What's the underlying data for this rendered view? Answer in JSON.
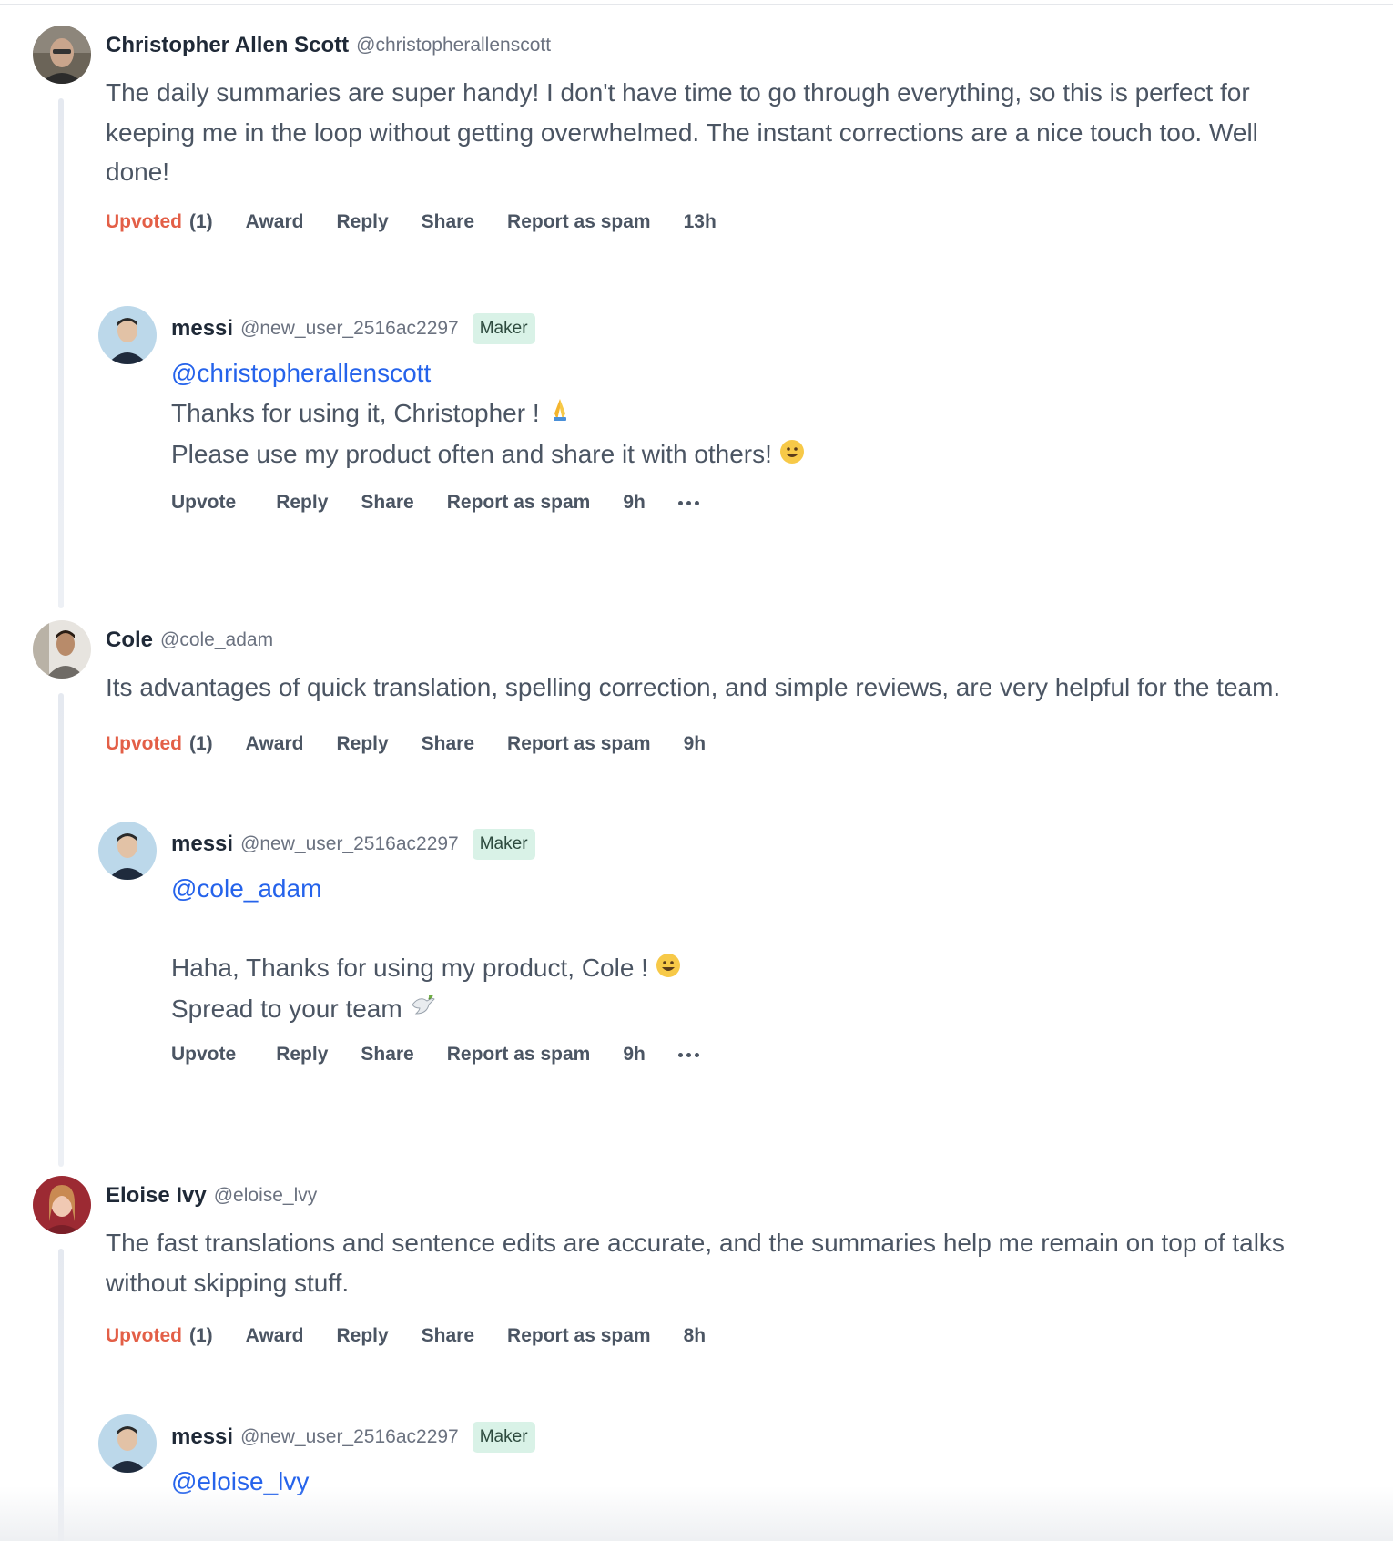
{
  "threads": [
    {
      "comment": {
        "name": "Christopher Allen Scott",
        "handle": "@christopherallenscott",
        "lines": [
          "The daily summaries are super handy! I don't have time to go through everything, so this is perfect for",
          "keeping me in the loop without getting overwhelmed. The instant corrections are a nice touch too. Well",
          "done!"
        ],
        "upvoted_label": "Upvoted",
        "upvote_count": "(1)",
        "award": "Award",
        "reply": "Reply",
        "share": "Share",
        "report": "Report as spam",
        "time": "13h"
      },
      "reply": {
        "name": "messi",
        "handle": "@new_user_2516ac2297",
        "badge": "Maker",
        "mention": "@christopherallenscott",
        "lines": [
          "Thanks for using it, Christopher !",
          "Please use my product often and share it with others!"
        ],
        "upvote": "Upvote",
        "reply": "Reply",
        "share": "Share",
        "report": "Report as spam",
        "time": "9h"
      }
    },
    {
      "comment": {
        "name": "Cole",
        "handle": "@cole_adam",
        "lines": [
          "Its advantages of quick translation, spelling correction, and simple reviews, are very helpful for the team."
        ],
        "upvoted_label": "Upvoted",
        "upvote_count": "(1)",
        "award": "Award",
        "reply": "Reply",
        "share": "Share",
        "report": "Report as spam",
        "time": "9h"
      },
      "reply": {
        "name": "messi",
        "handle": "@new_user_2516ac2297",
        "badge": "Maker",
        "mention": "@cole_adam",
        "lines": [
          "",
          "Haha, Thanks for using my product, Cole !",
          "Spread to your team"
        ],
        "upvote": "Upvote",
        "reply": "Reply",
        "share": "Share",
        "report": "Report as spam",
        "time": "9h"
      }
    },
    {
      "comment": {
        "name": "Eloise Ivy",
        "handle": "@eloise_lvy",
        "lines": [
          "The fast translations and sentence edits are accurate, and the summaries help me remain on top of talks",
          "without skipping stuff."
        ],
        "upvoted_label": "Upvoted",
        "upvote_count": "(1)",
        "award": "Award",
        "reply": "Reply",
        "share": "Share",
        "report": "Report as spam",
        "time": "8h"
      },
      "reply": {
        "name": "messi",
        "handle": "@new_user_2516ac2297",
        "badge": "Maker",
        "mention": "@eloise_lvy"
      }
    }
  ],
  "icons": {
    "pray": "folded-hands-emoji",
    "grin": "grinning-face-emoji",
    "dove": "dove-emoji",
    "more": "more-dots-icon"
  },
  "colors": {
    "upvoted": "#e35f47",
    "mention": "#2563eb",
    "maker_badge_bg": "#d9f2e7"
  }
}
